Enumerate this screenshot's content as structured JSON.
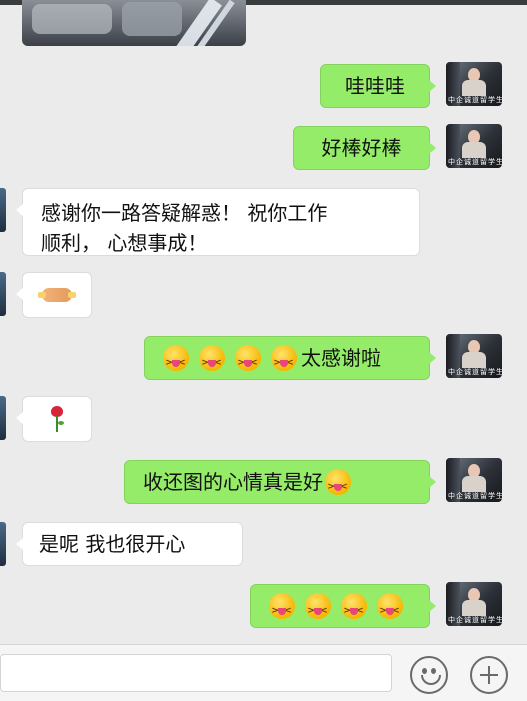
{
  "avatar_caption": "中企诚道留学生",
  "messages": [
    {
      "id": "m1",
      "side": "me",
      "text": "哇哇哇"
    },
    {
      "id": "m2",
      "side": "me",
      "text": "好棒好棒"
    },
    {
      "id": "m3",
      "side": "other",
      "line1": "感谢你一路答疑解惑！ 祝你工作",
      "line2": "顺利， 心想事成！"
    },
    {
      "id": "m4",
      "side": "other",
      "sticker": "handshake-emoji"
    },
    {
      "id": "m5",
      "side": "me",
      "emoji": [
        "squinting-tongue-emoji",
        "squinting-tongue-emoji",
        "squinting-tongue-emoji",
        "squinting-tongue-emoji"
      ],
      "text": "太感谢啦"
    },
    {
      "id": "m6",
      "side": "other",
      "sticker": "rose-emoji"
    },
    {
      "id": "m7",
      "side": "me",
      "text": "收还图的心情真是好",
      "trailing_emoji": "squinting-tongue-emoji"
    },
    {
      "id": "m8",
      "side": "other",
      "text": "是呢 我也很开心"
    },
    {
      "id": "m9",
      "side": "me",
      "emoji": [
        "squinting-tongue-emoji",
        "squinting-tongue-emoji",
        "squinting-tongue-emoji",
        "squinting-tongue-emoji"
      ]
    }
  ],
  "input_bar": {
    "text": "",
    "emoji_button_icon": "smiley-icon",
    "more_button_icon": "plus-icon"
  },
  "colors": {
    "my_bubble": "#95ec69",
    "other_bubble": "#ffffff",
    "background": "#ebebeb"
  }
}
